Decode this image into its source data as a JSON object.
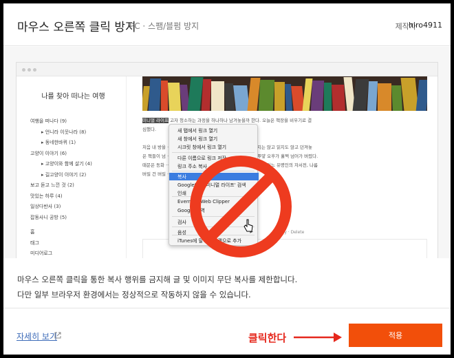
{
  "header": {
    "title": "마우스 오른쪽 클릭 방지",
    "subtitle": "PC · 스팸/블펌 방지",
    "author_label": "제작자",
    "author_name": "hiro4911"
  },
  "preview": {
    "blog_title": "나를 찾아 떠나는 여행",
    "nav_items": [
      {
        "label": "여행을 떠나다 (9)",
        "level": 0
      },
      {
        "label": "언니라 이웃나라 (8)",
        "level": 1
      },
      {
        "label": "동네한바퀴 (1)",
        "level": 1
      },
      {
        "label": "고양이 이야기 (6)",
        "level": 0
      },
      {
        "label": "고양이와 함께 살기 (4)",
        "level": 1
      },
      {
        "label": "길고양이 이야기 (2)",
        "level": 1
      },
      {
        "label": "보고 듣고 느낀 것 (2)",
        "level": 0
      },
      {
        "label": "맛있는 하루 (4)",
        "level": 0
      },
      {
        "label": "일상다반사 (3)",
        "level": 0
      },
      {
        "label": "잡동사니 공방 (5)",
        "level": 0
      },
      {
        "label": "홈",
        "level": 0,
        "gap": true
      },
      {
        "label": "태그",
        "level": 0
      },
      {
        "label": "미디어로그",
        "level": 0
      }
    ],
    "article_lines": [
      {
        "hl": "미니멀 라이프",
        "text": "고자 청소하는 과정을 하나하나 남겨놓을까 한다. 오늘은 책장을 비우기로 결"
      },
      {
        "hl": "",
        "text": "심했다."
      },
      {
        "hl": "",
        "text": ""
      },
      {
        "hl": "",
        "text": "처음 내 방을 ·········· 서재의 이미지였을 텐데, 몇 년간 정리하지는 않고 읽지도 않고 던져놓"
      },
      {
        "hl": "",
        "text": "은 책들이 넘 ·········· 은 책장 한 권 두 권 꺼내 분류하다 보니 뿌얗 오후가 훌쩍 넘어가 버렸다."
      },
      {
        "hl": "",
        "text": "때문은 동화 ·········· 중학교 숙제 때문에 한 번 읽고 펼쳐보지 않은 어느 유명인의 자서전, 나름"
      },
      {
        "hl": "",
        "text": "버릴 건 버릴 ·········· 에 많을 줄이야."
      }
    ],
    "actions": "Modify  ·  Delete",
    "context_menu": [
      "새 탭에서 링크 열기",
      "새 창에서 링크 열기",
      "시크릿 창에서 링크 열기",
      "다른 이름으로 링크 저장",
      "링크 주소 복사",
      "복사",
      "Google에서 '미니멀 라이프' 검색",
      "인쇄",
      "Evernote Web Clipper",
      "Google 번역",
      "검사",
      "음성",
      "iTunes에 말하기 트랙으로 추가"
    ]
  },
  "description": {
    "line1": "마우스 오른쪽 클릭을 통한 복사 행위를 금지해 글 및 이미지 무단 복사를 제한합니다.",
    "line2": "다만 일부 브라우저 환경에서는 정상적으로 작동하지 않을 수 있습니다."
  },
  "footer": {
    "more_link": "자세히 보기",
    "annotation": "클릭한다",
    "apply_label": "적용"
  },
  "colors": {
    "accent": "#f24f0a",
    "annotation": "#e5271c",
    "link": "#3d6bb8",
    "prohibit": "#ee3b1f"
  }
}
